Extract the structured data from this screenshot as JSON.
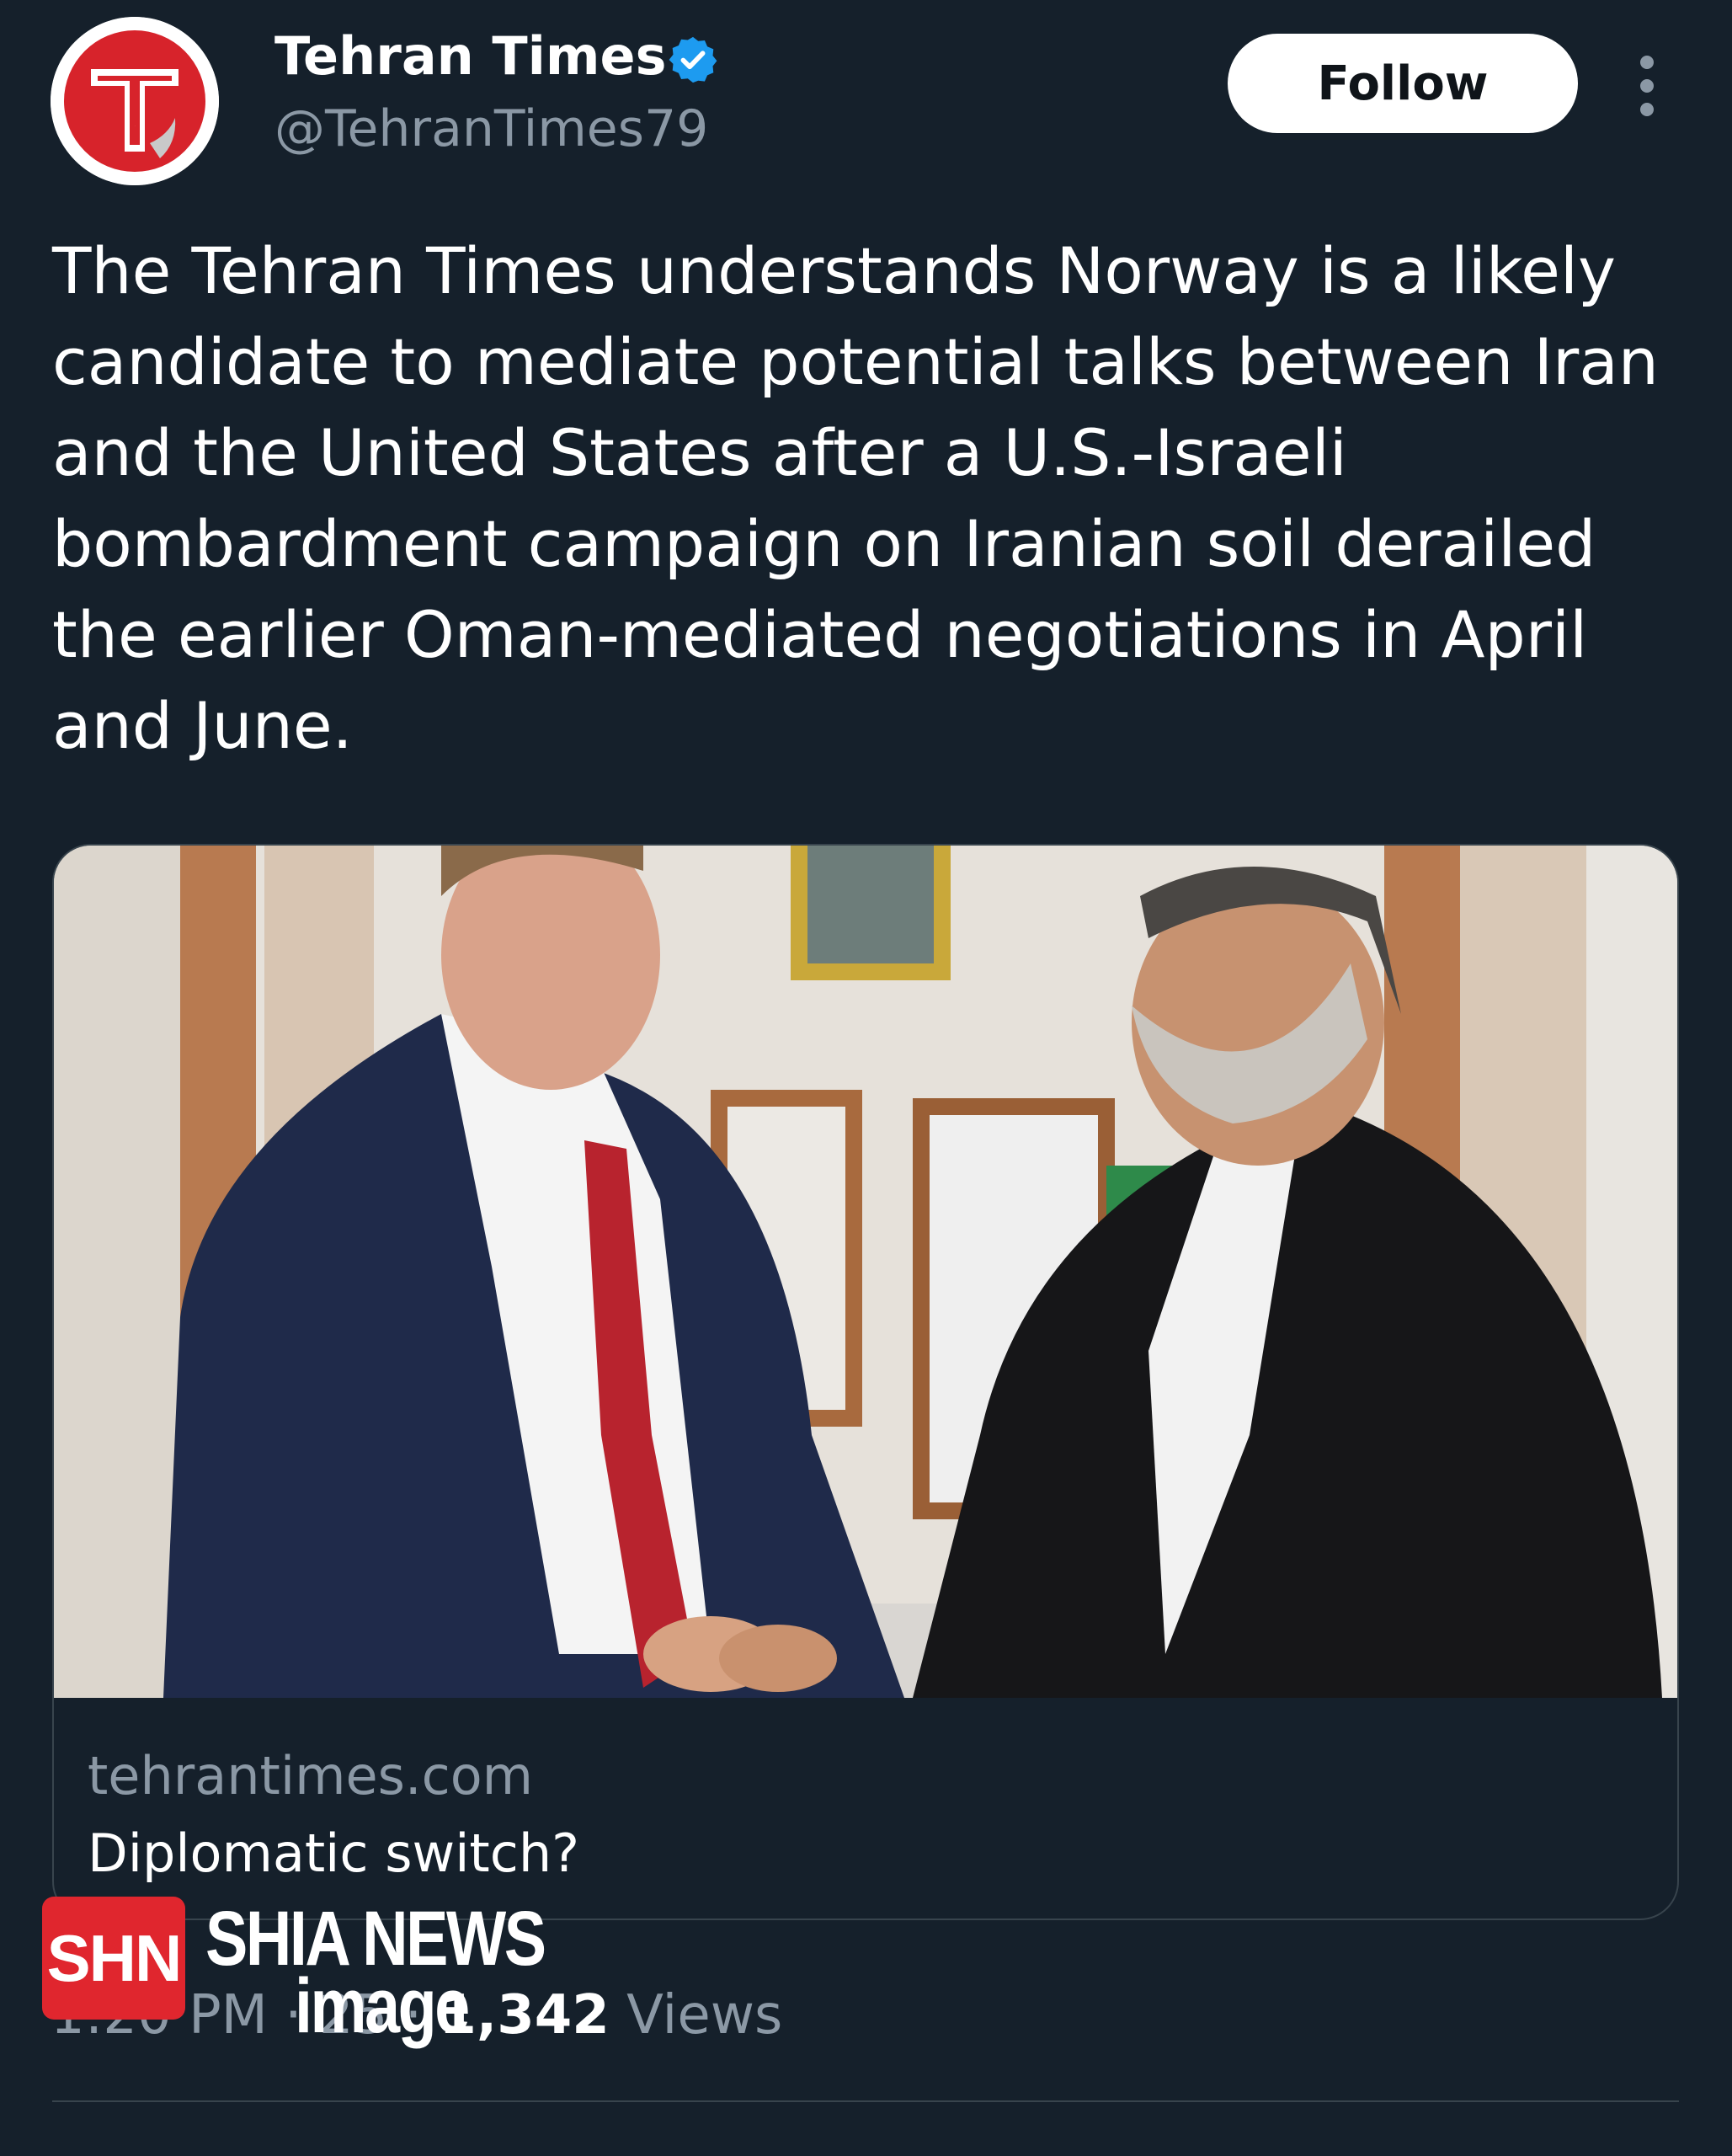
{
  "header": {
    "display_name": "Tehran Times",
    "handle": "@TehranTimes79",
    "avatar_letter": "T",
    "follow_label": "Follow",
    "verified_icon": "verified-badge-icon",
    "more_icon": "more-vertical-icon"
  },
  "tweet": {
    "text": "The Tehran Times understands Norway is a likely candidate to mediate potential talks between Iran and the United States after a U.S.-Israeli bombardment campaign on Iranian soil derailed the earlier Oman-mediated negotiations in April and June."
  },
  "card": {
    "domain": "tehrantimes.com",
    "title": "Diplomatic switch?"
  },
  "meta": {
    "time": "1:20 PM",
    "separator": "·",
    "date_partial": "25",
    "views_count": "1,342",
    "views_label": "Views"
  },
  "watermark": {
    "box": "SHN",
    "line1": "SHIA NEWS",
    "line2": "image"
  },
  "colors": {
    "background": "#15202b",
    "secondary_text": "#8b98a5",
    "verified_blue": "#1d9bf0",
    "border": "#38444d",
    "watermark_red": "#e0262e",
    "avatar_red": "#d7232b"
  }
}
